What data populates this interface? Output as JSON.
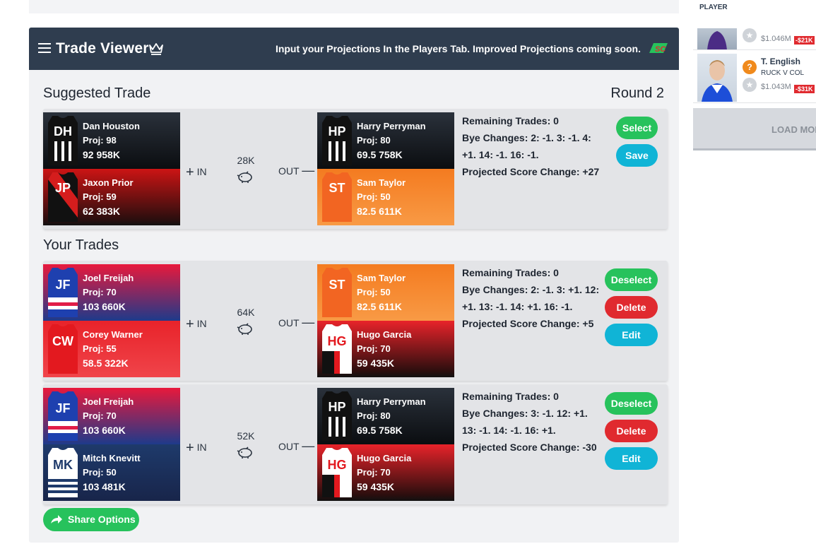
{
  "header": {
    "title": "Trade Viewer",
    "message": "Input your Projections In the Players Tab. Improved Projections coming soon.",
    "logo_text": "SC"
  },
  "suggested": {
    "section_title": "Suggested Trade",
    "round": "Round 2",
    "in_label": "IN",
    "out_label": "OUT",
    "cash": "28K",
    "in_players": [
      {
        "initials": "DH",
        "name": "Dan Houston",
        "proj": "Proj: 98",
        "price": "92 958K",
        "colors": [
          "#0a0a0a",
          "#1e2530"
        ]
      },
      {
        "initials": "JP",
        "name": "Jaxon Prior",
        "proj": "Proj: 59",
        "price": "62 383K",
        "colors": [
          "#cc1414",
          "#1a1a1a"
        ]
      }
    ],
    "out_players": [
      {
        "initials": "HP",
        "name": "Harry Perryman",
        "proj": "Proj: 80",
        "price": "69.5 758K",
        "colors": [
          "#0a0a0a",
          "#1e2530"
        ]
      },
      {
        "initials": "ST",
        "name": "Sam Taylor",
        "proj": "Proj: 50",
        "price": "82.5 611K",
        "colors": [
          "#f47b20",
          "#f7953f"
        ]
      }
    ],
    "info": [
      {
        "label": "Remaining Trades:",
        "value": "0"
      },
      {
        "label": "Bye Changes:",
        "value": "2: -1. 3: -1. 4: +1. 14: -1. 16: -1."
      },
      {
        "label": "Projected Score Change:",
        "value": "+27"
      }
    ],
    "buttons": {
      "select": "Select",
      "save": "Save"
    }
  },
  "your_trades": {
    "section_title": "Your Trades",
    "trades": [
      {
        "cash": "64K",
        "in_players": [
          {
            "initials": "JF",
            "name": "Joel Freijah",
            "proj": "Proj: 70",
            "price": "103 660K"
          },
          {
            "initials": "CW",
            "name": "Corey Warner",
            "proj": "Proj: 55",
            "price": "58.5 322K"
          }
        ],
        "out_players": [
          {
            "initials": "ST",
            "name": "Sam Taylor",
            "proj": "Proj: 50",
            "price": "82.5 611K"
          },
          {
            "initials": "HG",
            "name": "Hugo Garcia",
            "proj": "Proj: 70",
            "price": "59 435K"
          }
        ],
        "remaining": "0",
        "bye": "2: -1. 3: +1. 12: +1. 13: -1. 14: +1. 16: -1.",
        "score_change": "+5"
      },
      {
        "cash": "52K",
        "in_players": [
          {
            "initials": "JF",
            "name": "Joel Freijah",
            "proj": "Proj: 70",
            "price": "103 660K"
          },
          {
            "initials": "MK",
            "name": "Mitch Knevitt",
            "proj": "Proj: 50",
            "price": "103 481K"
          }
        ],
        "out_players": [
          {
            "initials": "HP",
            "name": "Harry Perryman",
            "proj": "Proj: 80",
            "price": "69.5 758K"
          },
          {
            "initials": "HG",
            "name": "Hugo Garcia",
            "proj": "Proj: 70",
            "price": "59 435K"
          }
        ],
        "remaining": "0",
        "bye": "3: -1. 12: +1. 13: -1. 14: -1. 16: +1.",
        "score_change": "-30"
      }
    ],
    "labels": {
      "remaining": "Remaining Trades:",
      "bye": "Bye Changes:",
      "score": "Projected Score Change:"
    },
    "buttons": {
      "deselect": "Deselect",
      "delete": "Delete",
      "edit": "Edit"
    }
  },
  "share": {
    "label": "Share Options"
  },
  "sidebar": {
    "column_label": "PLAYER",
    "items": [
      {
        "price": "$1.046M",
        "delta": "-$21K"
      },
      {
        "name": "T. English",
        "position": "RUCK V COL",
        "price": "$1.043M",
        "delta": "-$31K",
        "badge": "?"
      }
    ],
    "load_more": "LOAD MORE"
  }
}
